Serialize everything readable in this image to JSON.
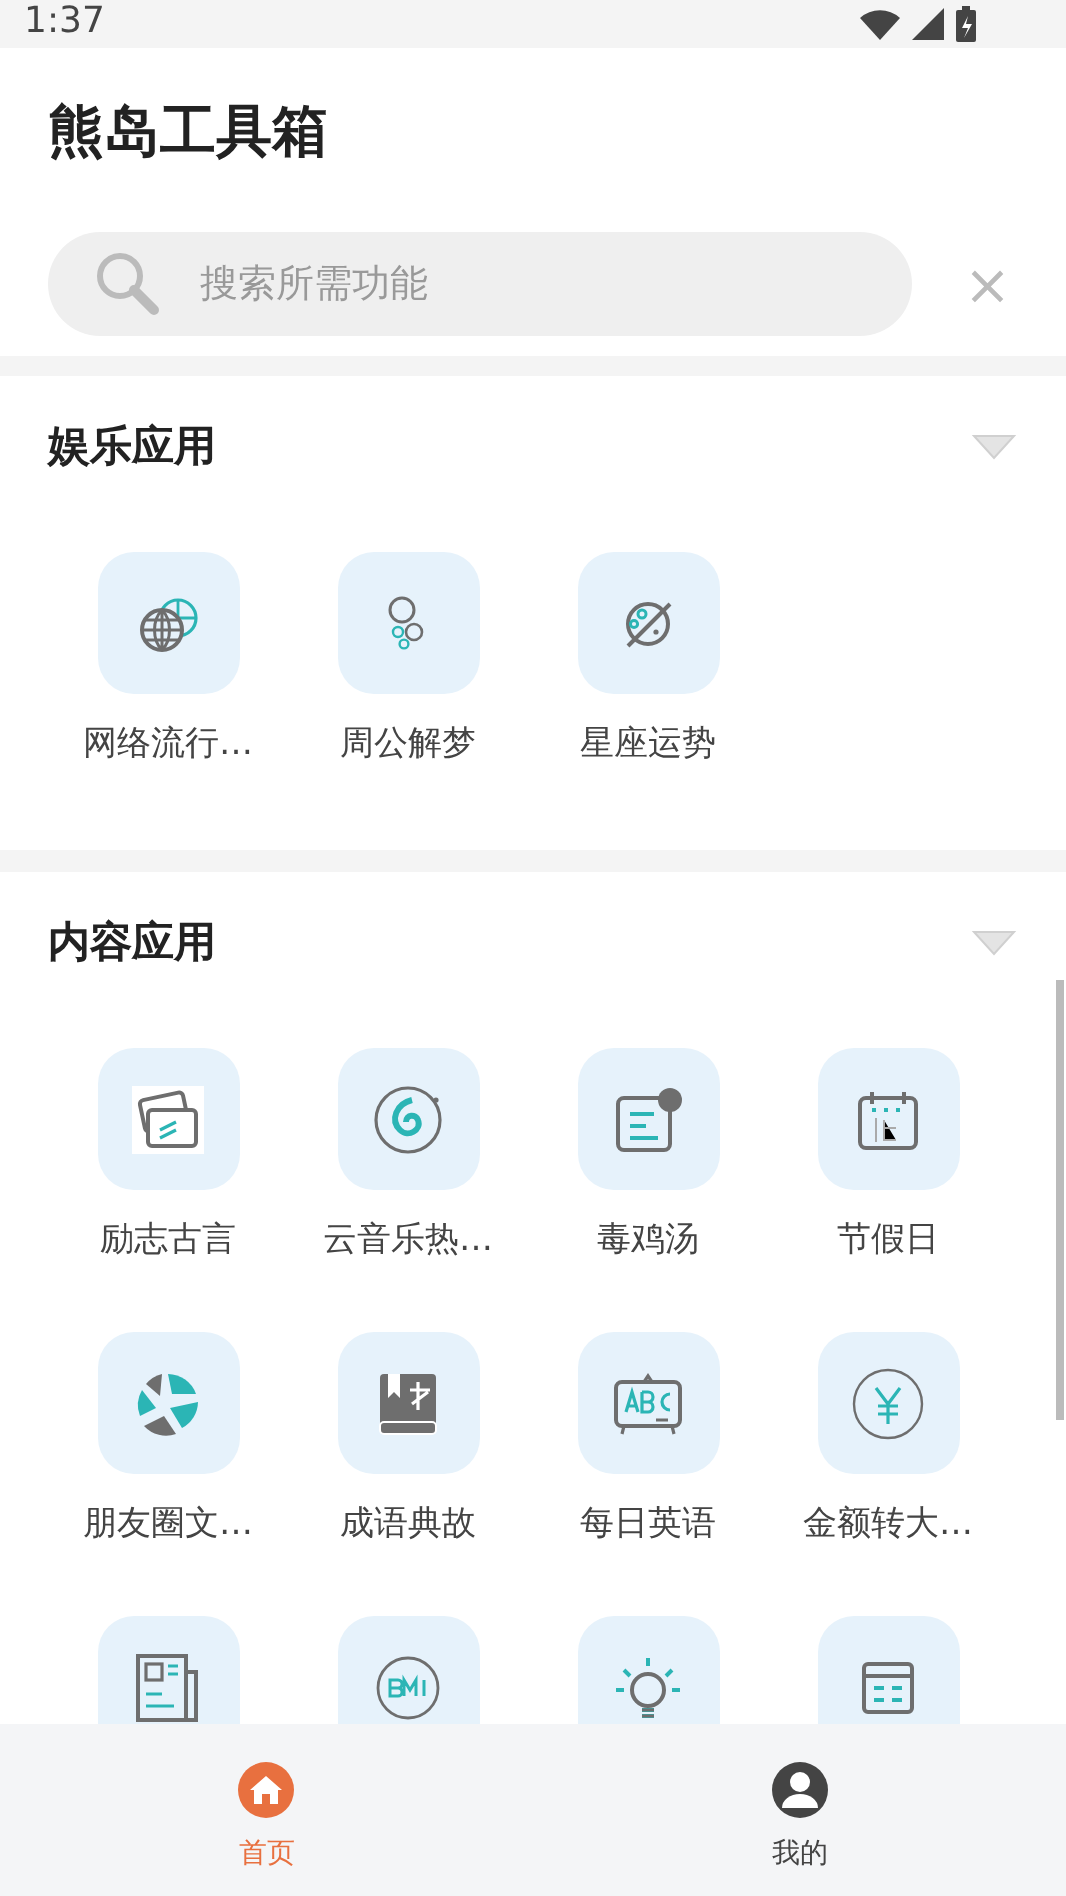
{
  "status_bar": {
    "time": "1:37"
  },
  "header": {
    "title": "熊岛工具箱"
  },
  "search": {
    "placeholder": "搜索所需功能",
    "clear": "×"
  },
  "sections": [
    {
      "title": "娱乐应用",
      "items": [
        {
          "label": "网络流行…"
        },
        {
          "label": "周公解梦"
        },
        {
          "label": "星座运势"
        }
      ]
    },
    {
      "title": "内容应用",
      "items": [
        {
          "kind": "labeled",
          "label": "励志古言"
        },
        {
          "kind": "labeled",
          "label": "云音乐热…"
        },
        {
          "kind": "labeled",
          "label": "毒鸡汤"
        },
        {
          "kind": "labeled",
          "label": "节假日"
        },
        {
          "kind": "labeled",
          "label": "朋友圈文…"
        },
        {
          "kind": "labeled",
          "label": "成语典故"
        },
        {
          "kind": "labeled",
          "label": "每日英语"
        },
        {
          "kind": "labeled",
          "label": "金额转大…"
        },
        {
          "kind": "cut_off"
        },
        {
          "kind": "cut_off"
        },
        {
          "kind": "cut_off"
        },
        {
          "kind": "cut_off"
        }
      ]
    }
  ],
  "bottom_nav": [
    {
      "label": "首页",
      "selected": true
    },
    {
      "label": "我的",
      "selected": false
    }
  ]
}
